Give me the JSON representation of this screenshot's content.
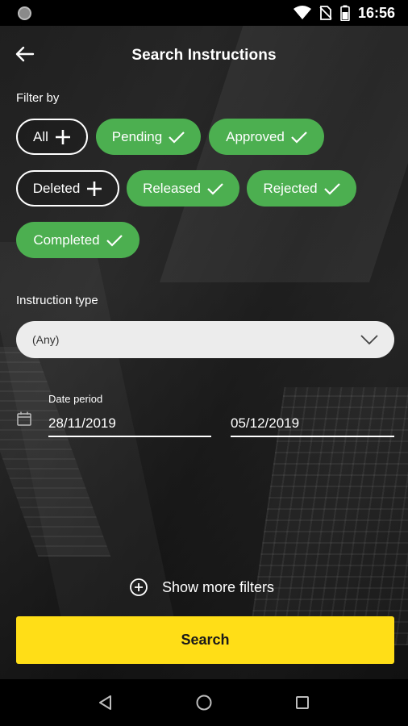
{
  "status_bar": {
    "time": "16:56",
    "icons": [
      "notification-dot-icon",
      "wifi-icon",
      "no-sim-icon",
      "battery-icon"
    ]
  },
  "header": {
    "title": "Search Instructions",
    "back_icon": "arrow-left-icon"
  },
  "filter": {
    "label": "Filter by",
    "chips": [
      {
        "label": "All",
        "selected": false,
        "icon": "plus-icon"
      },
      {
        "label": "Pending",
        "selected": true,
        "icon": "check-icon"
      },
      {
        "label": "Approved",
        "selected": true,
        "icon": "check-icon"
      },
      {
        "label": "Deleted",
        "selected": false,
        "icon": "plus-icon"
      },
      {
        "label": "Released",
        "selected": true,
        "icon": "check-icon"
      },
      {
        "label": "Rejected",
        "selected": true,
        "icon": "check-icon"
      },
      {
        "label": "Completed",
        "selected": true,
        "icon": "check-icon"
      }
    ]
  },
  "instruction_type": {
    "label": "Instruction type",
    "value": "(Any)",
    "icon": "chevron-down-icon"
  },
  "date_period": {
    "label": "Date period",
    "from": "28/11/2019",
    "to": "05/12/2019",
    "icon": "calendar-icon"
  },
  "more_filters": {
    "label": "Show more filters",
    "icon": "plus-circle-icon"
  },
  "search_button": {
    "label": "Search"
  },
  "nav_bar": {
    "icons": [
      "back-triangle-icon",
      "home-circle-icon",
      "recents-square-icon"
    ]
  },
  "colors": {
    "selected_chip": "#4caf50",
    "search_button": "#ffde17",
    "dropdown_bg": "#ececec"
  }
}
